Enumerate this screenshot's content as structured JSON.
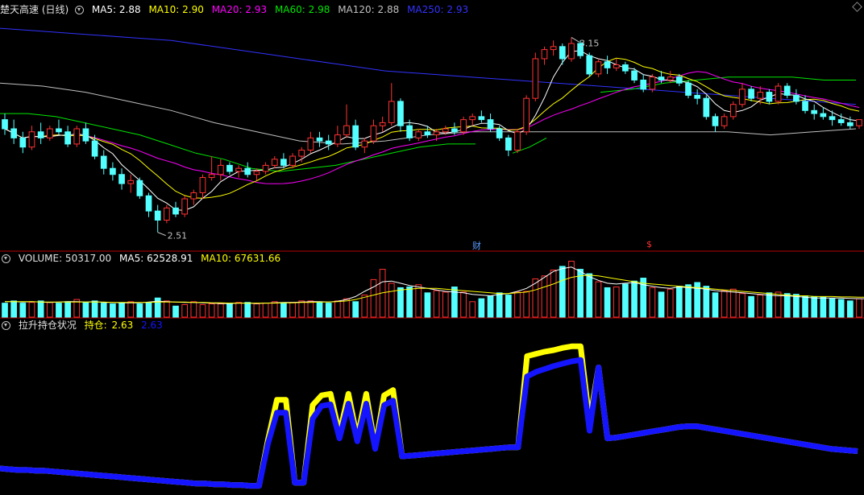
{
  "main_header": {
    "title": "楚天高速 (日线)",
    "ma5": "MA5: 2.88",
    "ma10": "MA10: 2.90",
    "ma20": "MA20: 2.93",
    "ma60": "MA60: 2.98",
    "ma120": "MA120: 2.88",
    "ma250": "MA250: 2.93"
  },
  "volume_header": {
    "volume": "VOLUME: 50317.00",
    "ma5": "MA5: 62528.91",
    "ma10": "MA10: 67631.66"
  },
  "indicator_header": {
    "name": "拉升持仓状况",
    "chicang_label": "持仓:",
    "chicang_value": "2.63",
    "value2": "2.63"
  },
  "markers": {
    "cai": "财",
    "s": "$"
  },
  "colors": {
    "up": "#ff3232",
    "down": "#54ffff",
    "ma5": "#ffffff",
    "ma10": "#ffff00",
    "ma20": "#ff00ff",
    "ma60": "#00e600",
    "ma120": "#c0c0c0",
    "ma250": "#3232ff",
    "indicator_yellow": "#ffff00",
    "indicator_blue": "#1414ff",
    "border": "#b40000"
  },
  "chart_data": [
    {
      "type": "candlestick",
      "title": "楚天高速 (日线)",
      "high_label": "3.15",
      "low_label": "2.51",
      "ohlc": [
        [
          2.88,
          2.9,
          2.83,
          2.85
        ],
        [
          2.85,
          2.88,
          2.8,
          2.82
        ],
        [
          2.82,
          2.84,
          2.77,
          2.79
        ],
        [
          2.79,
          2.86,
          2.78,
          2.84
        ],
        [
          2.84,
          2.87,
          2.8,
          2.82
        ],
        [
          2.82,
          2.86,
          2.81,
          2.85
        ],
        [
          2.85,
          2.88,
          2.83,
          2.84
        ],
        [
          2.84,
          2.86,
          2.79,
          2.8
        ],
        [
          2.8,
          2.86,
          2.79,
          2.85
        ],
        [
          2.85,
          2.87,
          2.8,
          2.81
        ],
        [
          2.81,
          2.83,
          2.75,
          2.76
        ],
        [
          2.76,
          2.78,
          2.7,
          2.72
        ],
        [
          2.72,
          2.74,
          2.68,
          2.7
        ],
        [
          2.7,
          2.72,
          2.65,
          2.67
        ],
        [
          2.67,
          2.7,
          2.64,
          2.68
        ],
        [
          2.68,
          2.69,
          2.62,
          2.63
        ],
        [
          2.63,
          2.64,
          2.56,
          2.58
        ],
        [
          2.58,
          2.6,
          2.51,
          2.55
        ],
        [
          2.55,
          2.6,
          2.54,
          2.59
        ],
        [
          2.59,
          2.61,
          2.56,
          2.57
        ],
        [
          2.57,
          2.63,
          2.56,
          2.62
        ],
        [
          2.62,
          2.65,
          2.6,
          2.64
        ],
        [
          2.64,
          2.7,
          2.62,
          2.69
        ],
        [
          2.69,
          2.76,
          2.68,
          2.7
        ],
        [
          2.7,
          2.75,
          2.68,
          2.73
        ],
        [
          2.73,
          2.74,
          2.7,
          2.71
        ],
        [
          2.71,
          2.73,
          2.69,
          2.72
        ],
        [
          2.72,
          2.74,
          2.69,
          2.7
        ],
        [
          2.7,
          2.72,
          2.68,
          2.71
        ],
        [
          2.71,
          2.74,
          2.7,
          2.73
        ],
        [
          2.73,
          2.76,
          2.72,
          2.75
        ],
        [
          2.75,
          2.77,
          2.72,
          2.73
        ],
        [
          2.73,
          2.77,
          2.72,
          2.76
        ],
        [
          2.76,
          2.79,
          2.74,
          2.78
        ],
        [
          2.78,
          2.84,
          2.77,
          2.82
        ],
        [
          2.82,
          2.84,
          2.79,
          2.81
        ],
        [
          2.81,
          2.83,
          2.78,
          2.8
        ],
        [
          2.8,
          2.86,
          2.79,
          2.83
        ],
        [
          2.83,
          2.93,
          2.82,
          2.86
        ],
        [
          2.86,
          2.88,
          2.78,
          2.79
        ],
        [
          2.79,
          2.82,
          2.77,
          2.81
        ],
        [
          2.81,
          2.88,
          2.8,
          2.86
        ],
        [
          2.86,
          2.89,
          2.84,
          2.87
        ],
        [
          2.87,
          3.0,
          2.86,
          2.94
        ],
        [
          2.94,
          2.95,
          2.84,
          2.86
        ],
        [
          2.86,
          2.88,
          2.81,
          2.82
        ],
        [
          2.82,
          2.85,
          2.81,
          2.84
        ],
        [
          2.84,
          2.86,
          2.82,
          2.83
        ],
        [
          2.83,
          2.85,
          2.81,
          2.84
        ],
        [
          2.84,
          2.86,
          2.83,
          2.85
        ],
        [
          2.85,
          2.87,
          2.83,
          2.84
        ],
        [
          2.84,
          2.89,
          2.83,
          2.88
        ],
        [
          2.88,
          2.9,
          2.86,
          2.89
        ],
        [
          2.89,
          2.91,
          2.87,
          2.88
        ],
        [
          2.88,
          2.9,
          2.84,
          2.85
        ],
        [
          2.85,
          2.86,
          2.81,
          2.82
        ],
        [
          2.82,
          2.83,
          2.76,
          2.78
        ],
        [
          2.78,
          2.85,
          2.77,
          2.84
        ],
        [
          2.84,
          2.96,
          2.83,
          2.95
        ],
        [
          2.95,
          3.1,
          2.94,
          3.08
        ],
        [
          3.08,
          3.12,
          3.06,
          3.11
        ],
        [
          3.11,
          3.14,
          3.09,
          3.12
        ],
        [
          3.12,
          3.13,
          3.06,
          3.08
        ],
        [
          3.08,
          3.15,
          3.07,
          3.13
        ],
        [
          3.13,
          3.14,
          3.08,
          3.09
        ],
        [
          3.09,
          3.1,
          3.02,
          3.03
        ],
        [
          3.03,
          3.08,
          3.02,
          3.07
        ],
        [
          3.07,
          3.09,
          3.03,
          3.05
        ],
        [
          3.05,
          3.08,
          3.04,
          3.06
        ],
        [
          3.06,
          3.07,
          3.03,
          3.04
        ],
        [
          3.04,
          3.05,
          3.0,
          3.01
        ],
        [
          3.01,
          3.03,
          2.97,
          2.98
        ],
        [
          2.98,
          3.03,
          2.97,
          3.02
        ],
        [
          3.02,
          3.04,
          3.0,
          3.01
        ],
        [
          3.01,
          3.04,
          3.0,
          3.02
        ],
        [
          3.02,
          3.03,
          2.99,
          3.0
        ],
        [
          3.0,
          3.01,
          2.95,
          2.96
        ],
        [
          2.96,
          2.98,
          2.93,
          2.95
        ],
        [
          2.95,
          2.96,
          2.88,
          2.89
        ],
        [
          2.89,
          2.9,
          2.84,
          2.86
        ],
        [
          2.86,
          2.9,
          2.85,
          2.89
        ],
        [
          2.89,
          2.94,
          2.88,
          2.93
        ],
        [
          2.93,
          3.0,
          2.92,
          2.98
        ],
        [
          2.98,
          2.99,
          2.94,
          2.95
        ],
        [
          2.95,
          2.99,
          2.93,
          2.97
        ],
        [
          2.97,
          2.98,
          2.93,
          2.94
        ],
        [
          2.94,
          3.0,
          2.93,
          2.99
        ],
        [
          2.99,
          3.0,
          2.95,
          2.96
        ],
        [
          2.96,
          2.98,
          2.93,
          2.94
        ],
        [
          2.94,
          2.96,
          2.9,
          2.91
        ],
        [
          2.91,
          2.93,
          2.88,
          2.9
        ],
        [
          2.9,
          2.92,
          2.88,
          2.89
        ],
        [
          2.89,
          2.91,
          2.86,
          2.88
        ],
        [
          2.88,
          2.9,
          2.86,
          2.87
        ],
        [
          2.87,
          2.89,
          2.85,
          2.86
        ],
        [
          2.86,
          2.88,
          2.85,
          2.88
        ]
      ],
      "ma250": [
        3.18,
        3.17,
        3.16,
        3.15,
        3.14,
        3.12,
        3.1,
        3.08,
        3.06,
        3.04,
        3.03,
        3.02,
        3.01,
        3.0,
        2.99,
        2.98,
        2.97,
        2.96,
        2.95,
        2.94,
        2.93
      ],
      "ma120": [
        3.0,
        2.99,
        2.97,
        2.94,
        2.91,
        2.87,
        2.84,
        2.81,
        2.8,
        2.81,
        2.83,
        2.84,
        2.84,
        2.84,
        2.84,
        2.84,
        2.84,
        2.84,
        2.83,
        2.84,
        2.85
      ],
      "ma60_a": [
        2.9,
        2.9,
        2.89,
        2.87,
        2.85,
        2.83,
        2.8,
        2.77,
        2.75,
        2.72,
        2.71,
        2.72,
        2.73,
        2.75,
        2.77,
        2.79,
        2.8,
        2.8
      ],
      "ma60_b": [
        2.77,
        2.79,
        2.82
      ],
      "ma60_c": [
        2.97,
        2.98,
        3.0,
        3.01,
        3.02,
        3.02,
        3.02,
        3.01,
        3.01
      ]
    },
    {
      "type": "bar",
      "title": "VOLUME",
      "values": [
        38,
        44,
        38,
        40,
        44,
        40,
        38,
        42,
        48,
        40,
        44,
        38,
        36,
        38,
        42,
        36,
        40,
        52,
        44,
        30,
        34,
        42,
        34,
        36,
        36,
        36,
        40,
        40,
        36,
        38,
        42,
        38,
        40,
        44,
        44,
        40,
        38,
        44,
        50,
        42,
        60,
        102,
        130,
        92,
        80,
        82,
        88,
        66,
        72,
        68,
        82,
        68,
        42,
        50,
        58,
        66,
        60,
        68,
        70,
        104,
        112,
        128,
        138,
        152,
        130,
        118,
        96,
        80,
        82,
        90,
        98,
        106,
        80,
        68,
        76,
        84,
        88,
        94,
        84,
        66,
        72,
        76,
        64,
        56,
        60,
        66,
        68,
        64,
        62,
        58,
        56,
        54,
        50,
        48,
        44,
        50,
        48
      ],
      "ma5": [
        42,
        42,
        41,
        42,
        41,
        40,
        41,
        42,
        42,
        41,
        42,
        40,
        40,
        39,
        39,
        39,
        41,
        43,
        42,
        41,
        40,
        40,
        39,
        38,
        37,
        37,
        38,
        38,
        37,
        38,
        39,
        40,
        40,
        41,
        42,
        42,
        41,
        43,
        48,
        56,
        70,
        82,
        96,
        98,
        92,
        86,
        82,
        78,
        74,
        70,
        68,
        66,
        62,
        60,
        58,
        62,
        64,
        70,
        78,
        92,
        108,
        124,
        132,
        136,
        124,
        110,
        100,
        92,
        90,
        92,
        94,
        88,
        84,
        80,
        78,
        82,
        80,
        78,
        76,
        72,
        70,
        68,
        66,
        64,
        62,
        60,
        58,
        58,
        56,
        54,
        52,
        52,
        52,
        52,
        51,
        50,
        50
      ],
      "ma10": [
        42,
        42,
        42,
        42,
        41,
        41,
        41,
        41,
        41,
        41,
        41,
        41,
        40,
        40,
        40,
        40,
        40,
        41,
        41,
        41,
        41,
        40,
        40,
        39,
        39,
        38,
        38,
        38,
        38,
        38,
        38,
        39,
        39,
        40,
        40,
        41,
        41,
        42,
        44,
        48,
        54,
        60,
        66,
        70,
        74,
        76,
        78,
        78,
        78,
        76,
        74,
        72,
        70,
        68,
        66,
        64,
        64,
        66,
        68,
        74,
        82,
        90,
        100,
        108,
        112,
        114,
        112,
        108,
        104,
        100,
        96,
        92,
        90,
        88,
        86,
        84,
        82,
        80,
        78,
        76,
        74,
        72,
        70,
        68,
        66,
        64,
        62,
        60,
        58,
        58,
        56,
        56,
        56,
        55,
        55,
        54,
        54
      ]
    },
    {
      "type": "line",
      "title": "拉升持仓状况",
      "series": [
        {
          "name": "持仓",
          "color": "#ffff00",
          "values": [
            1.12,
            1.11,
            1.1,
            1.1,
            1.09,
            1.09,
            1.08,
            1.07,
            1.06,
            1.05,
            1.04,
            1.03,
            1.02,
            1.01,
            1.0,
            0.99,
            0.98,
            0.97,
            0.96,
            0.95,
            0.94,
            0.93,
            0.92,
            0.92,
            0.91,
            0.91,
            0.9,
            0.9,
            0.89,
            0.89,
            1.5,
            2.03,
            2.03,
            0.93,
            0.93,
            1.96,
            2.09,
            2.11,
            1.58,
            2.11,
            1.52,
            2.11,
            1.4,
            2.09,
            2.16,
            1.28,
            1.29,
            1.3,
            1.31,
            1.32,
            1.33,
            1.34,
            1.35,
            1.36,
            1.37,
            1.38,
            1.39,
            1.4,
            1.4,
            2.61,
            2.64,
            2.67,
            2.69,
            2.72,
            2.74,
            2.74,
            1.74,
            2.46,
            1.52,
            1.53,
            1.55,
            1.57,
            1.59,
            1.61,
            1.63,
            1.65,
            1.67,
            1.68,
            1.68,
            1.66,
            1.64,
            1.62,
            1.6,
            1.58,
            1.56,
            1.54,
            1.52,
            1.5,
            1.48,
            1.46,
            1.44,
            1.42,
            1.4,
            1.38,
            1.37,
            1.36,
            1.35
          ]
        },
        {
          "name": "",
          "color": "#1414ff",
          "values": [
            1.12,
            1.11,
            1.1,
            1.1,
            1.09,
            1.09,
            1.08,
            1.07,
            1.06,
            1.05,
            1.04,
            1.03,
            1.02,
            1.01,
            1.0,
            0.99,
            0.98,
            0.97,
            0.96,
            0.95,
            0.94,
            0.93,
            0.92,
            0.92,
            0.91,
            0.91,
            0.9,
            0.9,
            0.89,
            0.89,
            1.45,
            1.86,
            1.86,
            0.93,
            0.93,
            1.78,
            1.95,
            1.97,
            1.52,
            1.98,
            1.48,
            1.98,
            1.38,
            1.96,
            2.02,
            1.28,
            1.29,
            1.3,
            1.31,
            1.32,
            1.33,
            1.34,
            1.35,
            1.36,
            1.37,
            1.38,
            1.39,
            1.4,
            1.4,
            2.34,
            2.4,
            2.44,
            2.48,
            2.51,
            2.54,
            2.56,
            1.62,
            2.46,
            1.52,
            1.53,
            1.55,
            1.57,
            1.59,
            1.61,
            1.63,
            1.65,
            1.67,
            1.68,
            1.68,
            1.66,
            1.64,
            1.62,
            1.6,
            1.58,
            1.56,
            1.54,
            1.52,
            1.5,
            1.48,
            1.46,
            1.44,
            1.42,
            1.4,
            1.38,
            1.37,
            1.36,
            1.35
          ]
        }
      ]
    }
  ]
}
